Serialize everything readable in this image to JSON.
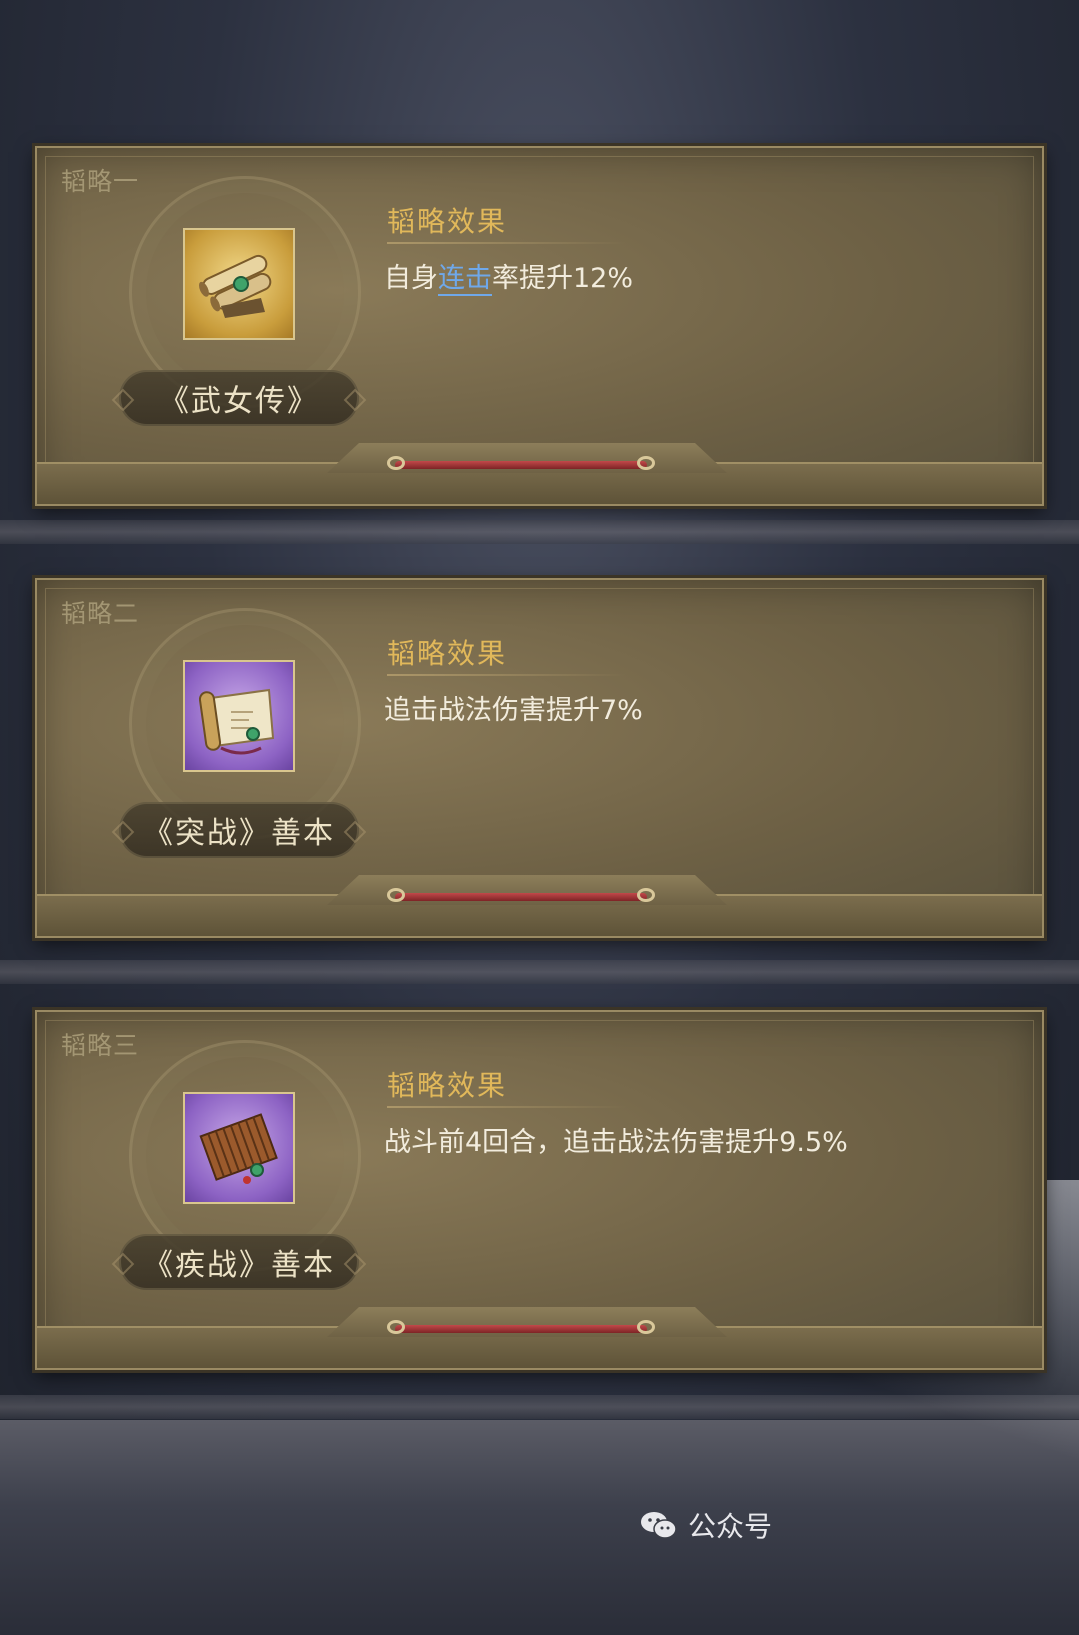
{
  "cards": [
    {
      "slot": "韬略一",
      "item_name": "《武女传》",
      "effect_title": "韬略效果",
      "effect_before": "自身",
      "effect_link": "连击",
      "effect_after": "率提升12%",
      "icon": "scroll-bundle-icon",
      "rarity_color": "#d9a64a"
    },
    {
      "slot": "韬略二",
      "item_name": "《突战》善本",
      "effect_title": "韬略效果",
      "effect_text": "追击战法伤害提升7%",
      "icon": "open-scroll-icon",
      "rarity_color": "#8d63c4"
    },
    {
      "slot": "韬略三",
      "item_name": "《疾战》善本",
      "effect_title": "韬略效果",
      "effect_text": "战斗前4回合，追击战法伤害提升9.5%",
      "icon": "bamboo-book-icon",
      "rarity_color": "#8d63c4"
    }
  ],
  "watermark": {
    "text": "公众号",
    "icon": "wechat-icon"
  }
}
